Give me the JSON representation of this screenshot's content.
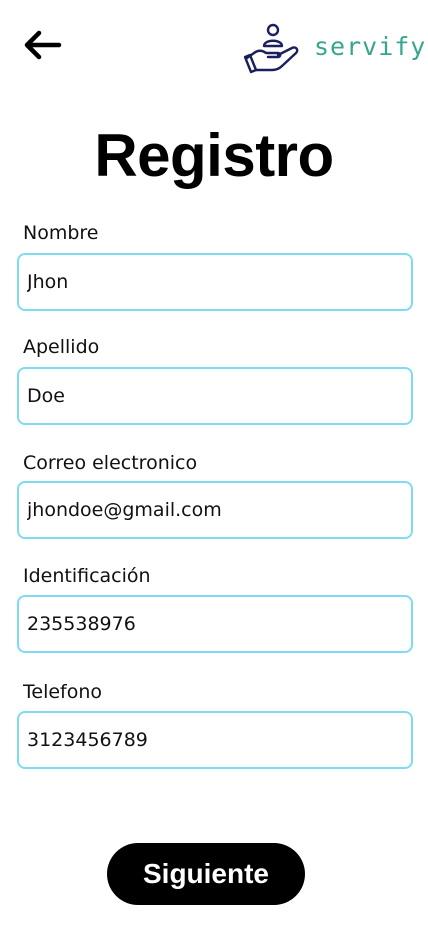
{
  "header": {
    "back_icon": "arrow-left-icon",
    "logo_icon": "hand-person-icon",
    "logo_text": "servify",
    "brand_color": "#3aa58e",
    "logo_icon_color": "#1b1f5e"
  },
  "title": "Registro",
  "form": {
    "field_border_color": "#7fdcf0",
    "fields": [
      {
        "label": "Nombre",
        "value": "Jhon"
      },
      {
        "label": "Apellido",
        "value": "Doe"
      },
      {
        "label": "Correo electronico",
        "value": "jhondoe@gmail.com"
      },
      {
        "label": "Identificación",
        "value": "235538976"
      },
      {
        "label": "Telefono",
        "value": "3123456789"
      }
    ]
  },
  "actions": {
    "next_label": "Siguiente"
  }
}
